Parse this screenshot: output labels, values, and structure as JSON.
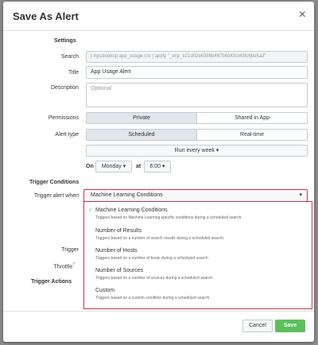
{
  "dialog": {
    "title": "Save As Alert",
    "close_glyph": "×"
  },
  "settings": {
    "heading": "Settings",
    "search_label": "Search",
    "search_value": "| inputlookup app_usage.csv | apply \"_exp_e21d02e6386b467b6ef0b343fc6be5a3\"",
    "title_label": "Title",
    "title_value": "App Usage Alert",
    "description_label": "Description",
    "description_placeholder": "Optional",
    "permissions_label": "Permissions",
    "permissions_options": [
      "Private",
      "Shared in App"
    ],
    "permissions_selected": "Private",
    "alert_type_label": "Alert type",
    "alert_type_options": [
      "Scheduled",
      "Real-time"
    ],
    "alert_type_selected": "Scheduled",
    "schedule_value": "Run every week ▾",
    "on_label": "On",
    "day_value": "Monday ▾",
    "at_label": "at",
    "time_value": "6:00 ▾"
  },
  "trigger": {
    "heading": "Trigger Conditions",
    "when_label": "Trigger alert when",
    "when_value": "Machine Learning Conditions",
    "trigger_label": "Trigger",
    "throttle_label": "Throttle",
    "throttle_help": "?",
    "options": [
      {
        "title": "Machine Learning Conditions",
        "desc": "Triggers based on Machine Learning specific conditions during a scheduled search.",
        "selected": true
      },
      {
        "title": "Number of Results",
        "desc": "Triggers based on a number of search results during a scheduled search."
      },
      {
        "title": "Number of Hosts",
        "desc": "Triggers based on a number of hosts during a scheduled search."
      },
      {
        "title": "Number of Sources",
        "desc": "Triggers based on a number of sources during a scheduled search."
      },
      {
        "title": "Custom",
        "desc": "Triggers based on a custom condition during a scheduled search."
      }
    ]
  },
  "actions": {
    "heading": "Trigger Actions"
  },
  "footer": {
    "cancel_label": "Cancel",
    "save_label": "Save"
  }
}
